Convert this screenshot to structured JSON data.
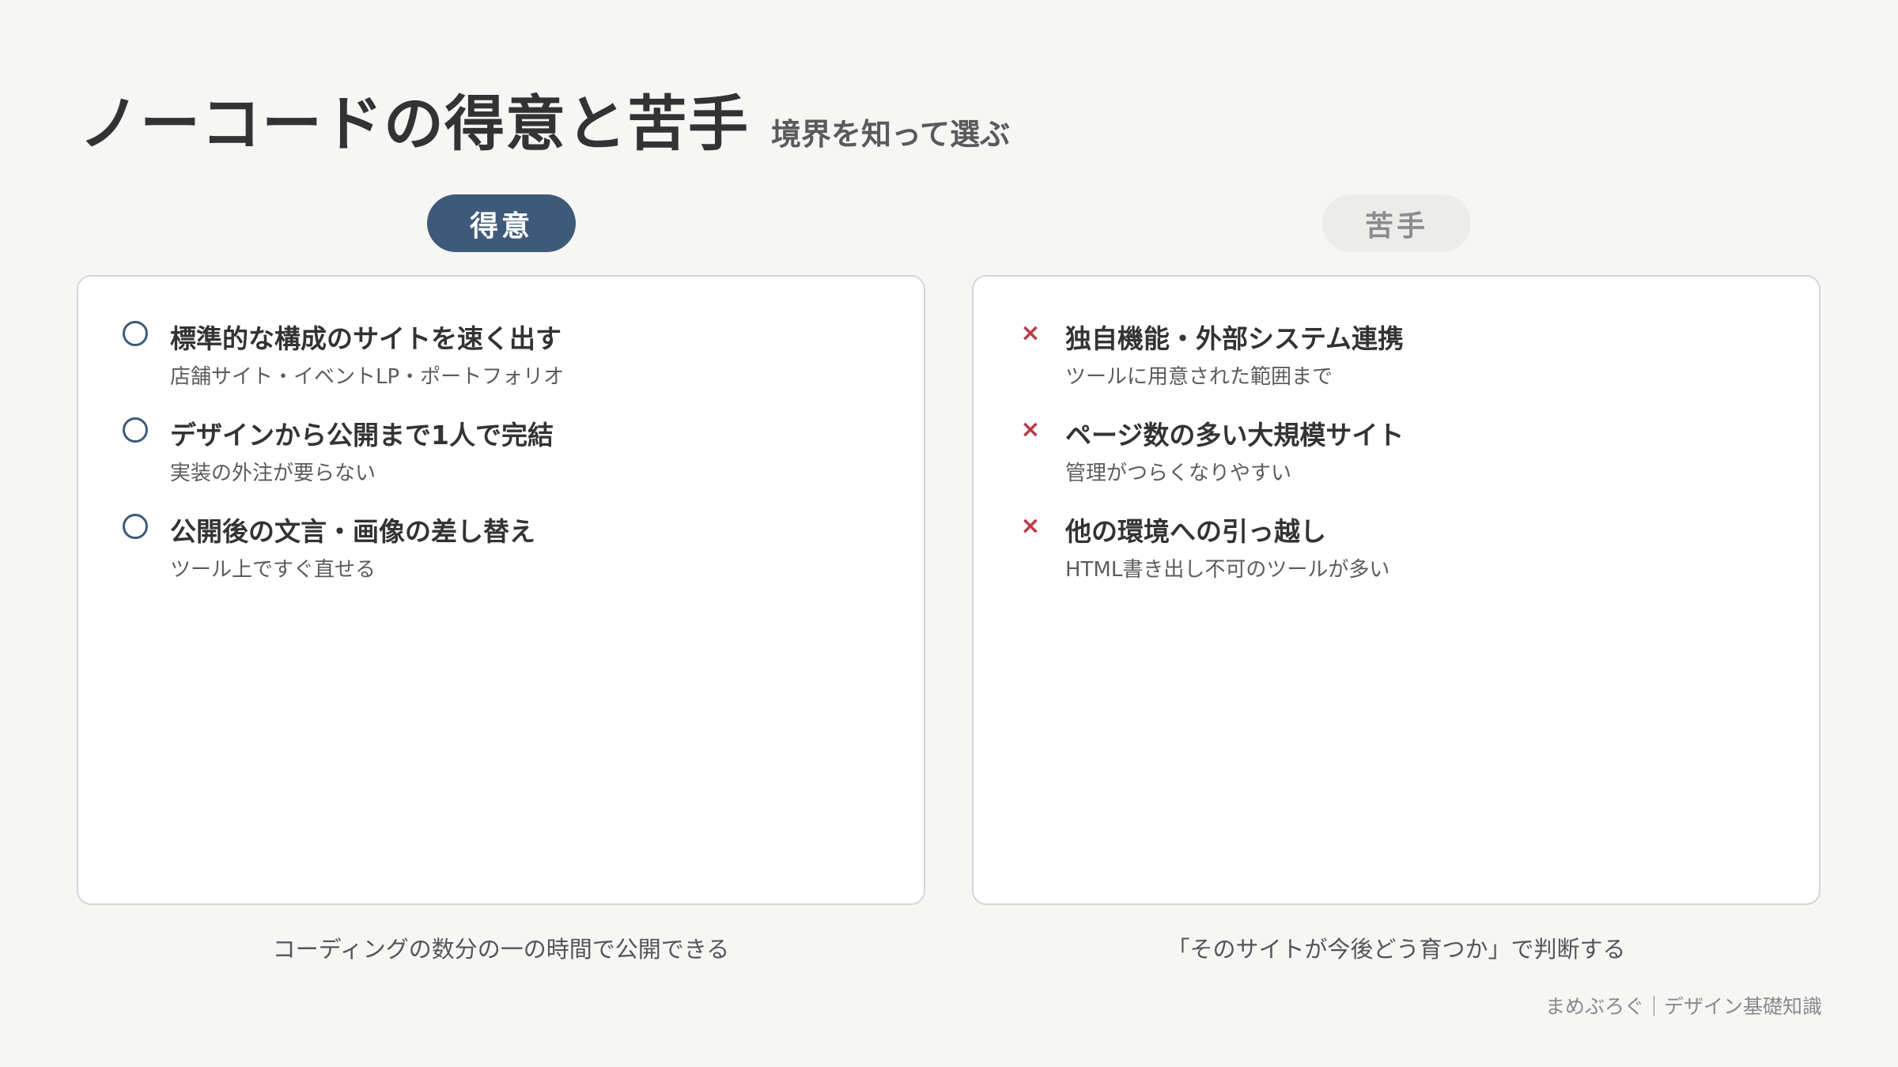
{
  "header": {
    "title": "ノーコードの得意と苦手",
    "subtitle": "境界を知って選ぶ"
  },
  "strengths": {
    "label": "得意",
    "marker": "circle-icon",
    "accent": "#3e5a78",
    "items": [
      {
        "title": "標準的な構成のサイトを速く出す",
        "desc": "店舗サイト・イベントLP・ポートフォリオ"
      },
      {
        "title": "デザインから公開まで1人で完結",
        "desc": "実装の外注が要らない"
      },
      {
        "title": "公開後の文言・画像の差し替え",
        "desc": "ツール上ですぐ直せる"
      }
    ],
    "caption": "コーディングの数分の一の時間で公開できる"
  },
  "weaknesses": {
    "label": "苦手",
    "marker": "cross-icon",
    "marker_glyph": "×",
    "accent": "#b83a4b",
    "items": [
      {
        "title": "独自機能・外部システム連携",
        "desc": "ツールに用意された範囲まで"
      },
      {
        "title": "ページ数の多い大規模サイト",
        "desc": "管理がつらくなりやすい"
      },
      {
        "title": "他の環境への引っ越し",
        "desc": "HTML書き出し不可のツールが多い"
      }
    ],
    "caption": "「そのサイトが今後どう育つか」で判断する"
  },
  "footer": {
    "text": "まめぶろぐ｜デザイン基礎知識"
  }
}
